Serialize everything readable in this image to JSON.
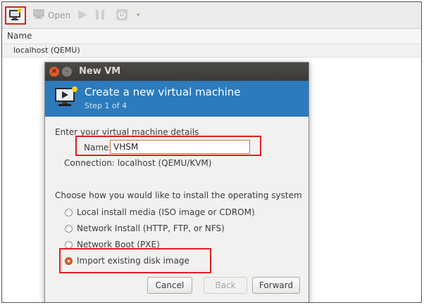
{
  "toolbar": {
    "open_label": "Open"
  },
  "list": {
    "column_header": "Name",
    "host": "localhost (QEMU)"
  },
  "dialog": {
    "title": "New VM",
    "banner_title": "Create a new virtual machine",
    "banner_step": "Step 1 of 4",
    "details_heading": "Enter your virtual machine details",
    "name_label": "Name:",
    "name_value": "VHSM",
    "connection_label": "Connection:",
    "connection_value": "localhost (QEMU/KVM)",
    "install_heading": "Choose how you would like to install the operating system",
    "options": [
      {
        "label": "Local install media (ISO image or CDROM)",
        "selected": false
      },
      {
        "label": "Network Install (HTTP, FTP, or NFS)",
        "selected": false
      },
      {
        "label": "Network Boot (PXE)",
        "selected": false
      },
      {
        "label": "Import existing disk image",
        "selected": true
      }
    ],
    "buttons": {
      "cancel": "Cancel",
      "back": "Back",
      "forward": "Forward"
    }
  },
  "colors": {
    "banner": "#2c7bbd",
    "highlight": "#e02020",
    "radio_selected": "#e0622e"
  }
}
